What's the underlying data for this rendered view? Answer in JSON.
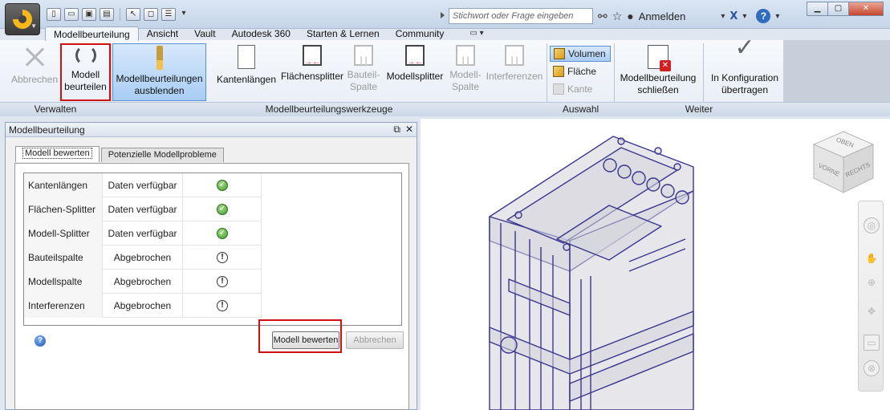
{
  "titlebar": {
    "search_placeholder": "Stichwort oder Frage eingeben",
    "signin_label": "Anmelden",
    "help_label": "?"
  },
  "tabs": [
    {
      "label": "Modellbeurteilung",
      "active": true
    },
    {
      "label": "Ansicht"
    },
    {
      "label": "Vault"
    },
    {
      "label": "Autodesk 360"
    },
    {
      "label": "Starten & Lernen"
    },
    {
      "label": "Community"
    }
  ],
  "ribbon": {
    "abbrechen": "Abbrechen",
    "modell_beurteilen": [
      "Modell",
      "beurteilen"
    ],
    "ausblenden": [
      "Modellbeurteilungen",
      "ausblenden"
    ],
    "kantenlaengen": "Kantenlängen",
    "flaechensplitter": "Flächensplitter",
    "bauteilspalte": [
      "Bauteil-",
      "Spalte"
    ],
    "modellsplitter": "Modellsplitter",
    "modellspalte": [
      "Modell-",
      "Spalte"
    ],
    "interferenzen": "Interferenzen",
    "volumen": "Volumen",
    "flaeche": "Fläche",
    "kante": "Kante",
    "schliessen": [
      "Modellbeurteilung",
      "schließen"
    ],
    "uebertragen": [
      "In Konfiguration",
      "übertragen"
    ],
    "panels": {
      "verwalten": "Verwalten",
      "werkzeuge": "Modellbeurteilungswerkzeuge",
      "auswahl": "Auswahl",
      "weiter": "Weiter"
    }
  },
  "dialog": {
    "title": "Modellbeurteilung",
    "tabs": [
      "Modell bewerten",
      "Potenzielle Modellprobleme"
    ],
    "rows": [
      {
        "name": "Kantenlängen",
        "status": "Daten verfügbar",
        "state": "ok"
      },
      {
        "name": "Flächen-Splitter",
        "status": "Daten verfügbar",
        "state": "ok"
      },
      {
        "name": "Modell-Splitter",
        "status": "Daten verfügbar",
        "state": "ok"
      },
      {
        "name": "Bauteilspalte",
        "status": "Abgebrochen",
        "state": "warn"
      },
      {
        "name": "Modellspalte",
        "status": "Abgebrochen",
        "state": "warn"
      },
      {
        "name": "Interferenzen",
        "status": "Abgebrochen",
        "state": "warn"
      }
    ],
    "evaluate_button": "Modell bewerten",
    "cancel_button": "Abbrechen"
  },
  "viewcube": {
    "top": "OBEN",
    "front": "VORNE",
    "right": "RECHTS"
  },
  "colors": {
    "accent": "#5b8fd0",
    "highlight_red": "#d01010",
    "model_edge": "#3a3590"
  }
}
